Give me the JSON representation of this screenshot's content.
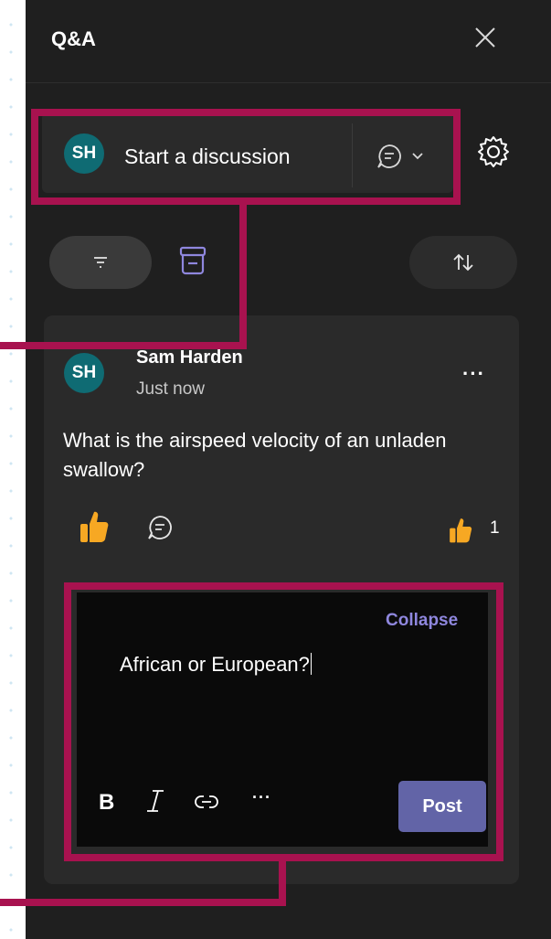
{
  "header": {
    "title": "Q&A"
  },
  "composer": {
    "avatar_initials": "SH",
    "placeholder": "Start a discussion"
  },
  "post": {
    "avatar_initials": "SH",
    "author": "Sam Harden",
    "timestamp": "Just now",
    "more": "···",
    "question": "What is the airspeed velocity of an unladen swallow?",
    "like_count": "1"
  },
  "reply_editor": {
    "collapse_label": "Collapse",
    "text": "African or European?",
    "bold_label": "B",
    "more_label": "···",
    "post_label": "Post"
  },
  "colors": {
    "panel": "#1f1f1f",
    "card": "#2a2a2a",
    "editor": "#0a0a0a",
    "avatar": "#0f6b73",
    "accent": "#6264a7",
    "link": "#8f87de",
    "like": "#f7a823",
    "callout": "#a8124f"
  },
  "icons": [
    "close-icon",
    "chat-icon",
    "chevron-down-icon",
    "gear-icon",
    "filter-icon",
    "archive-icon",
    "sort-icon",
    "thumbs-up-icon",
    "reply-icon",
    "italic-icon",
    "link-icon"
  ]
}
